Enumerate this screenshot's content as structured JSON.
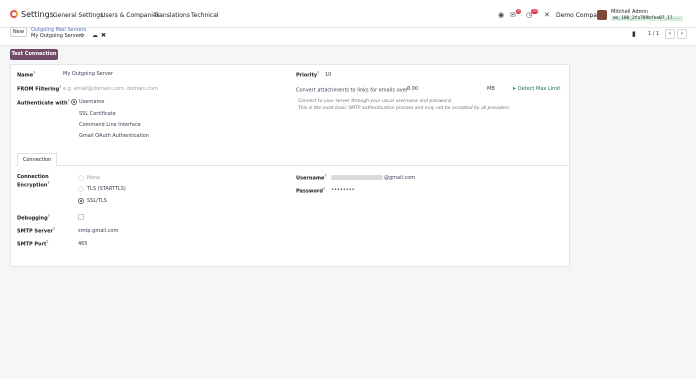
{
  "app": {
    "title": "Settings",
    "menu": [
      "General Settings",
      "Users & Companies",
      "Translations",
      "Technical"
    ]
  },
  "systray": {
    "chat_badge": "6",
    "activity_badge": "25",
    "company": "Demo Company",
    "user_name": "Mitchell Admin",
    "db_name": "mo_180_2fa789bfee07_17..."
  },
  "control_panel": {
    "new_label": "New",
    "breadcrumb": "Outgoing Mail Servers",
    "record_name": "My Outgoing Server",
    "pager": "1 / 1"
  },
  "actions": {
    "test_connection": "Test Connection"
  },
  "form": {
    "name_label": "Name",
    "name_value": "My Outgoing Server",
    "from_filter_label": "FROM Filtering",
    "from_filter_placeholder": "e.g. email@domain.com, domain.com",
    "auth_label": "Authenticate with",
    "auth_options": [
      "Username",
      "SSL Certificate",
      "Command Line Interface",
      "Gmail OAuth Authentication"
    ],
    "priority_label": "Priority",
    "priority_value": "10",
    "convert_label": "Convert attachments to links for emails over",
    "convert_value": "0.00",
    "convert_unit": "MB",
    "detect_label": "Detect Max Limit",
    "note_line1": "Connect to your server through your usual username and password.",
    "note_line2": "This is the most basic SMTP authentication process and may not be accepted by all providers."
  },
  "tabs": {
    "connection": "Connection"
  },
  "connection": {
    "encryption_label_1": "Connection",
    "encryption_label_2": "Encryption",
    "encryption_options": [
      "None",
      "TLS (STARTTLS)",
      "SSL/TLS"
    ],
    "debugging_label": "Debugging",
    "smtp_server_label": "SMTP Server",
    "smtp_server_value": "smtp.gmail.com",
    "smtp_port_label": "SMTP Port",
    "smtp_port_value": "465",
    "username_label": "Username",
    "username_suffix": "@gmail.com",
    "password_label": "Password",
    "password_value": "••••••••"
  }
}
